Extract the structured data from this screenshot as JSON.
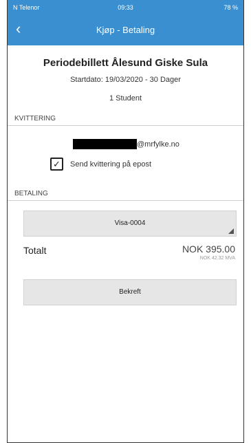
{
  "status_bar": {
    "carrier": "N Telenor",
    "time": "09:33",
    "battery": "78 %"
  },
  "nav": {
    "back_glyph": "‹",
    "title": "Kjøp - Betaling"
  },
  "ticket": {
    "title": "Periodebillett Ålesund Giske Sula",
    "start": "Startdato: 19/03/2020 - 30 Dager",
    "passengers": "1 Student"
  },
  "receipt": {
    "section_label": "KVITTERING",
    "email_domain": "@mrfylke.no",
    "send_checked": true,
    "send_label": "Send kvittering på epost"
  },
  "payment": {
    "section_label": "BETALING",
    "card": "Visa-0004",
    "total_label": "Totalt",
    "total_amount": "NOK 395.00",
    "vat": "NOK  42.32 MVA",
    "confirm_label": "Bekreft"
  },
  "colors": {
    "header": "#3a8fd0",
    "button_bg": "#e6e6e6"
  }
}
